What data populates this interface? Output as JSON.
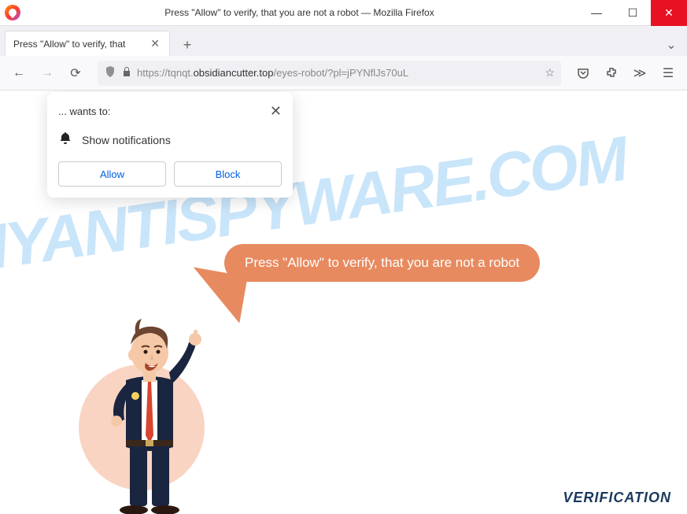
{
  "titlebar": {
    "title": "Press \"Allow\" to verify, that you are not a robot — Mozilla Firefox"
  },
  "tab": {
    "title": "Press \"Allow\" to verify, that"
  },
  "url": {
    "protocol": "https://",
    "subdomain": "tqnqt.",
    "domain": "obsidiancutter.top",
    "path": "/eyes-robot/?pl=jPYNflJs70uL"
  },
  "notification": {
    "origin": "... wants to:",
    "permission": "Show notifications",
    "allow": "Allow",
    "block": "Block"
  },
  "page": {
    "speech": "Press \"Allow\" to verify, that you are not a robot",
    "verification": "VERIFICATION"
  },
  "watermark": "MYANTISPYWARE.COM"
}
